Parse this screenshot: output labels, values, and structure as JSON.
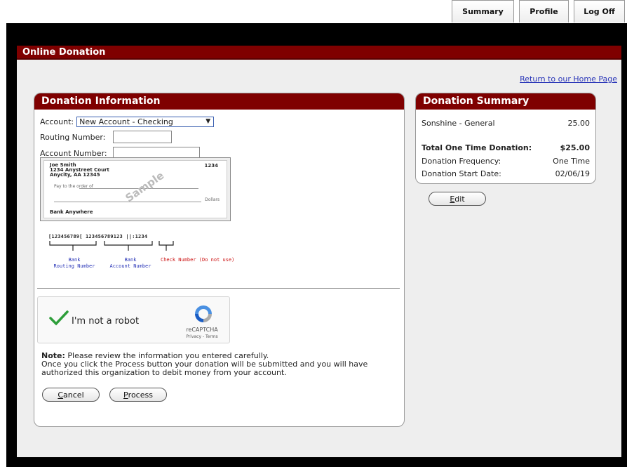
{
  "nav": {
    "tabs": [
      {
        "label": "Summary"
      },
      {
        "label": "Profile"
      },
      {
        "label": "Log Off"
      }
    ]
  },
  "page": {
    "title": "Online Donation",
    "home_link": "Return to our Home Page"
  },
  "donation_info": {
    "title": "Donation Information",
    "account_label": "Account:",
    "account_value": "New Account - Checking",
    "routing_label": "Routing Number:",
    "routing_value": "",
    "account_number_label": "Account Number:",
    "account_number_value": ""
  },
  "check": {
    "name": "Joe Smith",
    "address1": "1234 Anystreet Court",
    "address2": "Anycity, AA 12345",
    "number": "1234",
    "pay_to": "Pay to the order of",
    "dollars": "Dollars",
    "sample": "Sample",
    "bank": "Bank Anywhere",
    "micr": "[123456789[  123456789123 ||:1234",
    "legend_routing_1": "Bank",
    "legend_routing_2": "Routing Number",
    "legend_account_1": "Bank",
    "legend_account_2": "Account Number",
    "legend_check": "Check Number (Do not use)"
  },
  "captcha": {
    "label": "I'm not a robot",
    "brand": "reCAPTCHA",
    "links": "Privacy - Terms"
  },
  "note": {
    "bold": "Note:",
    "line1": " Please review the information you entered carefully.",
    "line2": "Once you click the Process button your donation will be submitted and you will have authorized this organization to debit money from your account."
  },
  "buttons": {
    "cancel_u": "C",
    "cancel_rest": "ancel",
    "process_u": "P",
    "process_rest": "rocess",
    "edit_u": "E",
    "edit_rest": "dit"
  },
  "summary": {
    "title": "Donation Summary",
    "fund_name": "Sonshine - General",
    "fund_amount": "25.00",
    "total_label": "Total One Time Donation:",
    "total_value": "$25.00",
    "frequency_label": "Donation Frequency:",
    "frequency_value": "One Time",
    "start_label": "Donation Start Date:",
    "start_value": "02/06/19"
  },
  "colors": {
    "brand": "#7f0000",
    "link": "#2a36b8",
    "check_red": "#cc1111"
  }
}
